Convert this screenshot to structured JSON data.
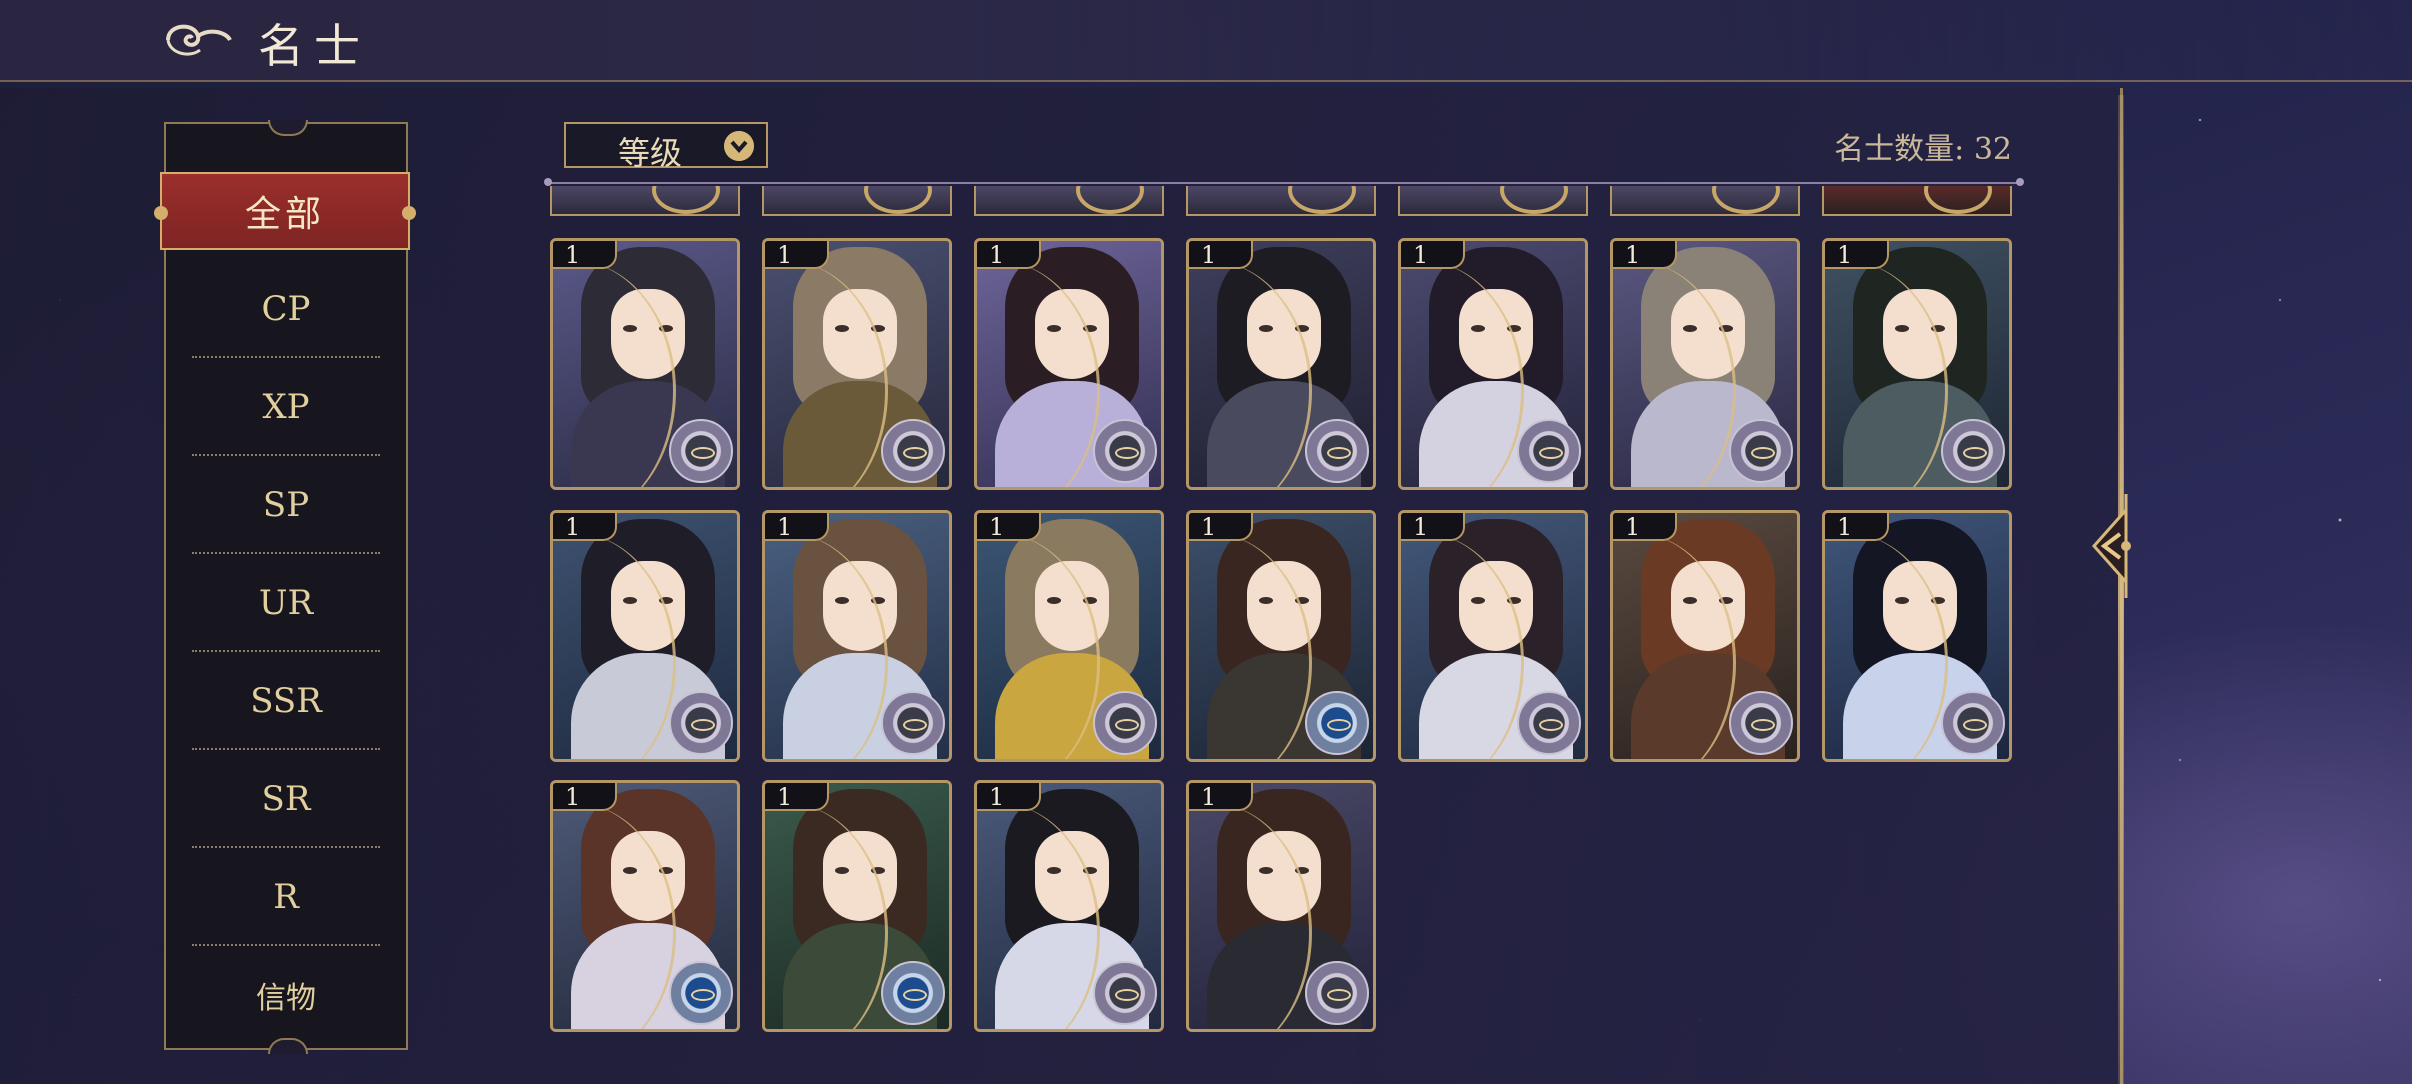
{
  "header": {
    "title": "名士",
    "icon": "cloud-swirl-icon"
  },
  "sidebar": {
    "items": [
      {
        "label": "全部",
        "active": true
      },
      {
        "label": "CP"
      },
      {
        "label": "XP"
      },
      {
        "label": "SP"
      },
      {
        "label": "UR"
      },
      {
        "label": "SSR"
      },
      {
        "label": "SR"
      },
      {
        "label": "R"
      },
      {
        "label": "信物"
      }
    ]
  },
  "toolbar": {
    "sort_label": "等级",
    "sort_icon": "chevron-down-icon",
    "count_text": "名士数量: 32"
  },
  "cards": [
    {
      "level": "1",
      "emblem": "dark"
    },
    {
      "level": "1",
      "emblem": "dark"
    },
    {
      "level": "1",
      "emblem": "dark"
    },
    {
      "level": "1",
      "emblem": "dark"
    },
    {
      "level": "1",
      "emblem": "dark"
    },
    {
      "level": "1",
      "emblem": "dark"
    },
    {
      "level": "1",
      "emblem": "dark"
    },
    {
      "level": "1",
      "emblem": "dark"
    },
    {
      "level": "1",
      "emblem": "dark"
    },
    {
      "level": "1",
      "emblem": "dark"
    },
    {
      "level": "1",
      "emblem": "blue"
    },
    {
      "level": "1",
      "emblem": "dark"
    },
    {
      "level": "1",
      "emblem": "dark"
    },
    {
      "level": "1",
      "emblem": "dark"
    },
    {
      "level": "1",
      "emblem": "blue"
    },
    {
      "level": "1",
      "emblem": "blue"
    },
    {
      "level": "1",
      "emblem": "dark"
    },
    {
      "level": "1",
      "emblem": "dark"
    }
  ],
  "colors": {
    "accent_gold": "#b49764",
    "active_red": "#9a2f2c",
    "label_gold": "#e2cf9e"
  }
}
